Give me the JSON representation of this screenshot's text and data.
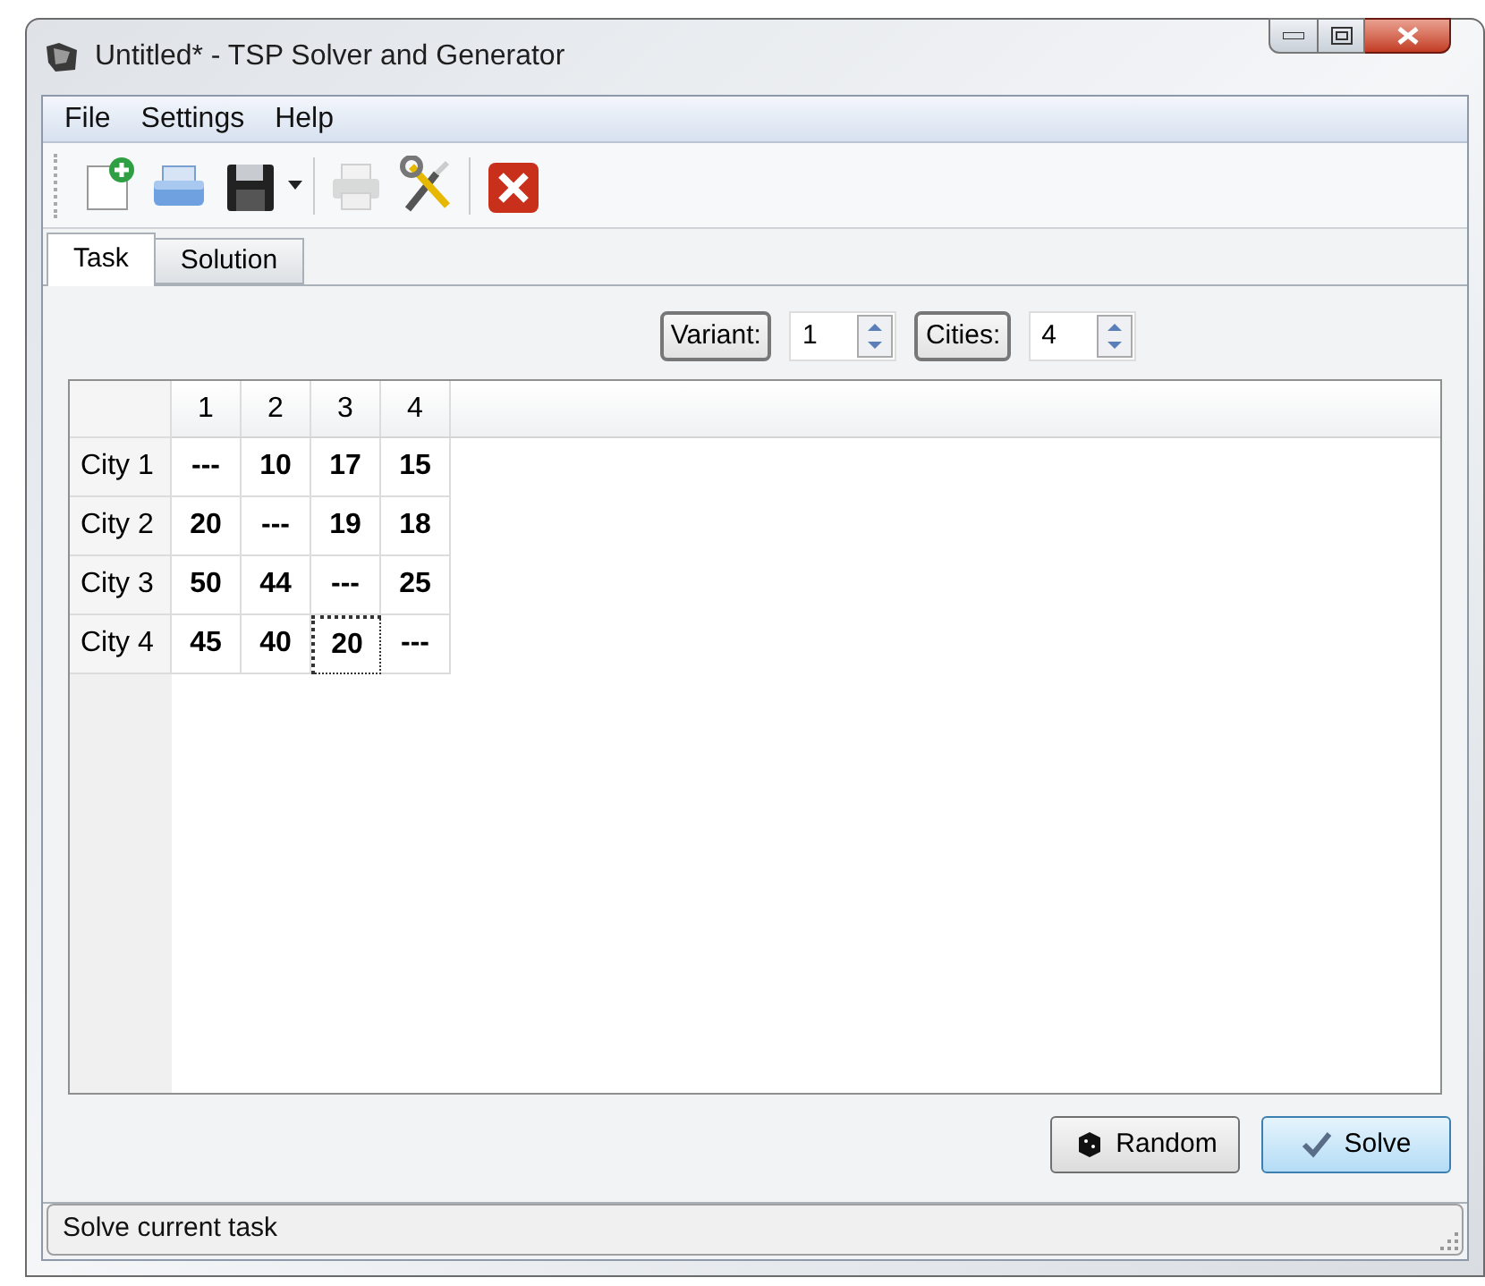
{
  "window": {
    "title": "Untitled* - TSP Solver and Generator"
  },
  "menu": [
    "File",
    "Settings",
    "Help"
  ],
  "toolbar": [
    {
      "kind": "new",
      "disabled": false
    },
    {
      "kind": "open",
      "disabled": false
    },
    {
      "kind": "save",
      "disabled": false
    },
    {
      "kind": "print",
      "disabled": true
    },
    {
      "kind": "tools",
      "disabled": false
    },
    {
      "kind": "close",
      "disabled": false
    }
  ],
  "tabs": [
    {
      "label": "Task",
      "selected": true
    },
    {
      "label": "Solution",
      "selected": false
    }
  ],
  "spinners": [
    {
      "label": "Variant:",
      "value": "1"
    },
    {
      "label": "Cities:",
      "value": "4"
    }
  ],
  "table": {
    "columns": [
      "1",
      "2",
      "3",
      "4"
    ],
    "rows": [
      {
        "header": "City 1",
        "cells": [
          {
            "text": "---",
            "selected": false
          },
          {
            "text": "10",
            "selected": false
          },
          {
            "text": "17",
            "selected": false
          },
          {
            "text": "15",
            "selected": false
          }
        ]
      },
      {
        "header": "City 2",
        "cells": [
          {
            "text": "20",
            "selected": false
          },
          {
            "text": "---",
            "selected": false
          },
          {
            "text": "19",
            "selected": false
          },
          {
            "text": "18",
            "selected": false
          }
        ]
      },
      {
        "header": "City 3",
        "cells": [
          {
            "text": "50",
            "selected": false
          },
          {
            "text": "44",
            "selected": false
          },
          {
            "text": "---",
            "selected": false
          },
          {
            "text": "25",
            "selected": false
          }
        ]
      },
      {
        "header": "City 4",
        "cells": [
          {
            "text": "45",
            "selected": false
          },
          {
            "text": "40",
            "selected": false
          },
          {
            "text": "20",
            "selected": true
          },
          {
            "text": "---",
            "selected": false
          }
        ]
      }
    ]
  },
  "buttons": [
    {
      "kind": "random",
      "label": "Random"
    },
    {
      "kind": "solve",
      "label": "Solve"
    }
  ],
  "status_bar": "Solve current task"
}
